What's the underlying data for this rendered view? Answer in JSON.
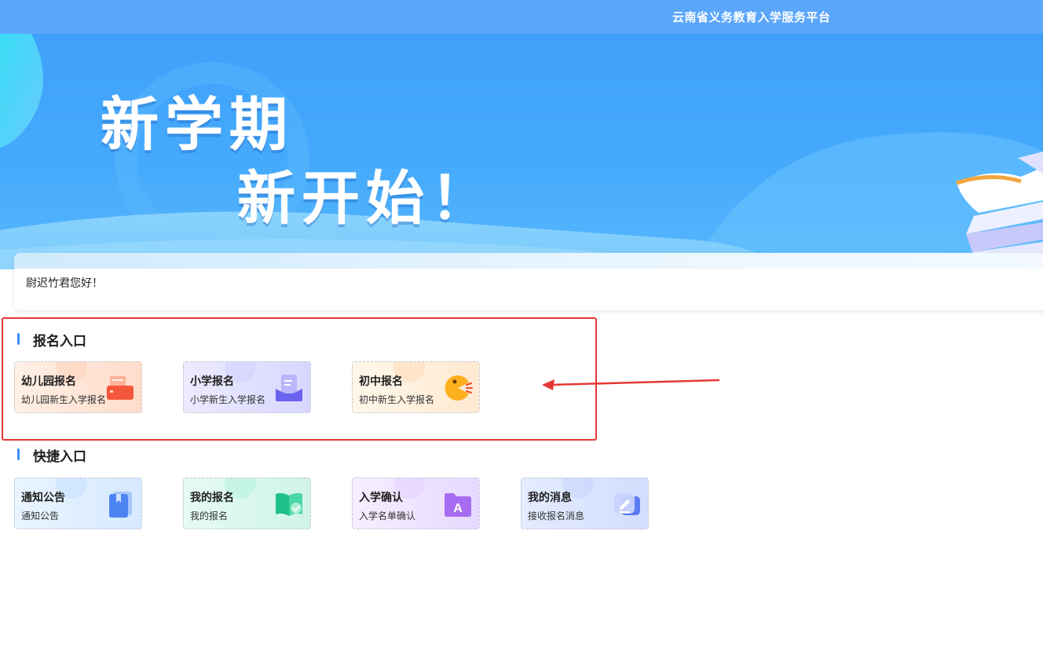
{
  "header": {
    "platform_title": "云南省义务教育入学服务平台"
  },
  "banner": {
    "line1": "新学期",
    "line2": "新开始！"
  },
  "greeting": {
    "text": "尉迟竹君您好！"
  },
  "registration": {
    "title": "报名入口",
    "tiles": [
      {
        "name": "幼儿园报名",
        "desc": "幼儿园新生入学报名",
        "icon": "printer-icon"
      },
      {
        "name": "小学报名",
        "desc": "小学新生入学报名",
        "icon": "document-tray-icon"
      },
      {
        "name": "初中报名",
        "desc": "初中新生入学报名",
        "icon": "chomper-icon"
      }
    ]
  },
  "shortcuts": {
    "title": "快捷入口",
    "tiles": [
      {
        "name": "通知公告",
        "desc": "通知公告",
        "icon": "notice-book-icon"
      },
      {
        "name": "我的报名",
        "desc": "我的报名",
        "icon": "open-book-check-icon"
      },
      {
        "name": "入学确认",
        "desc": "入学名单确认",
        "icon": "letter-a-folder-icon"
      },
      {
        "name": "我的消息",
        "desc": "接收报名消息",
        "icon": "message-edit-icon"
      }
    ]
  },
  "colors": {
    "header_bg": "#5aa6fb",
    "banner_bg": "#45aafc",
    "section_bar": "#3e8ef7",
    "annotation": "#e53935"
  }
}
